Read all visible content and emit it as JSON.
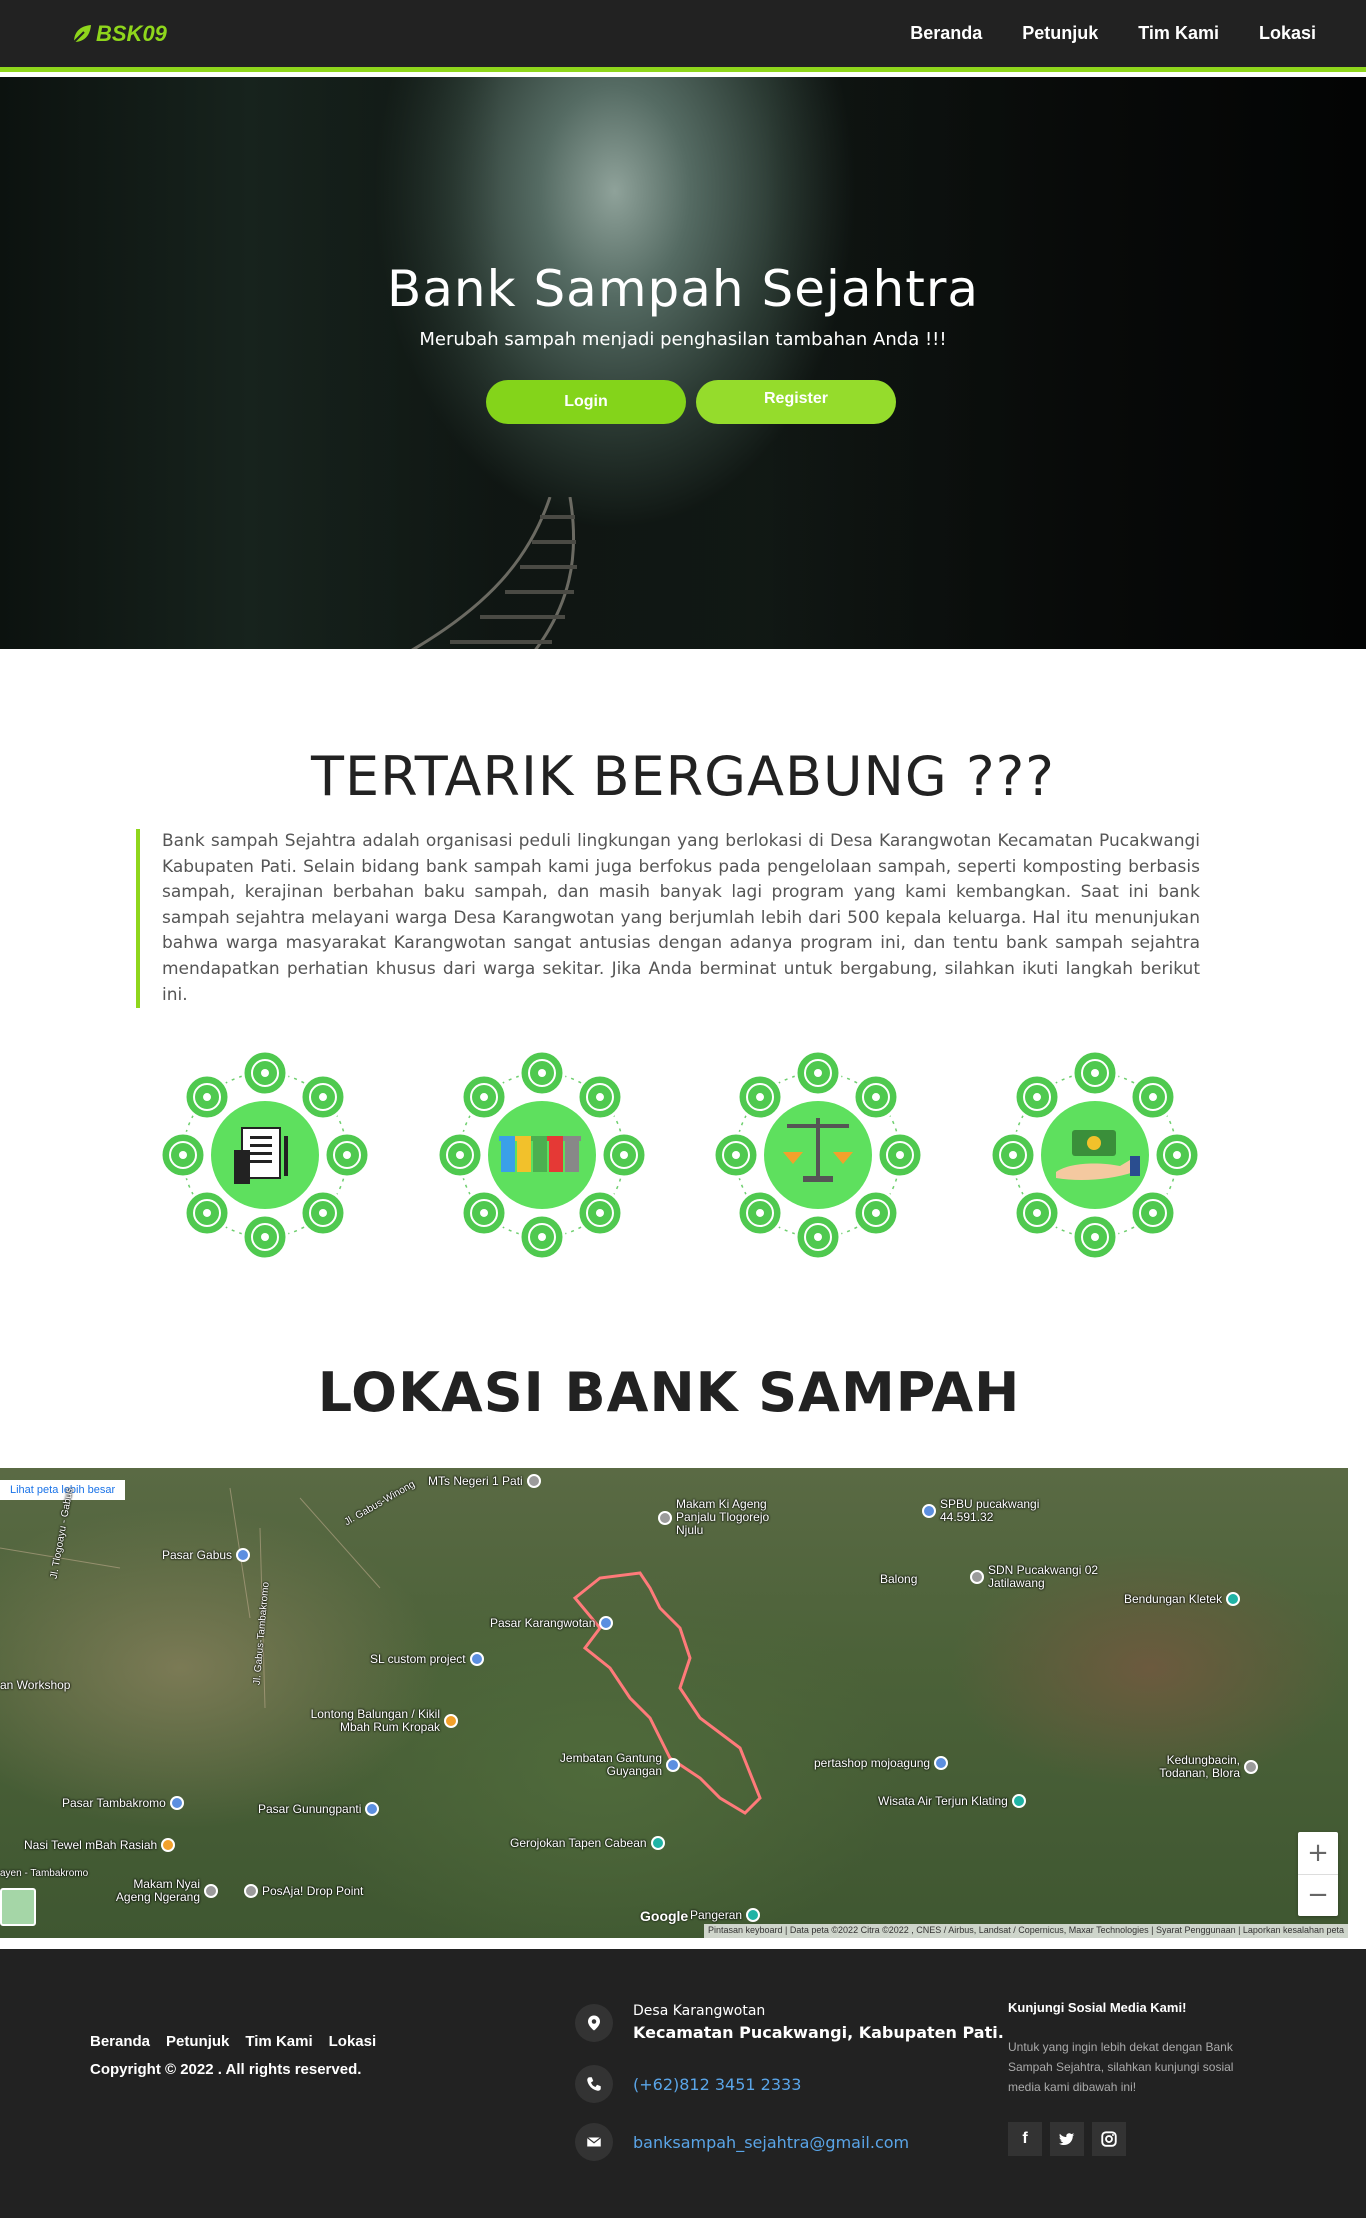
{
  "nav": {
    "logo": "BSK09",
    "items": [
      "Beranda",
      "Petunjuk",
      "Tim Kami",
      "Lokasi"
    ]
  },
  "hero": {
    "title": "Bank Sampah Sejahtra",
    "subtitle": "Merubah sampah menjadi penghasilan tambahan Anda !!!",
    "login_label": "Login",
    "register_label": "Register"
  },
  "join": {
    "title": "TERTARIK BERGABUNG ???",
    "text": "Bank sampah Sejahtra adalah organisasi peduli lingkungan yang berlokasi di Desa Karangwotan Kecamatan Pucakwangi Kabupaten Pati. Selain bidang bank sampah kami juga berfokus pada pengelolaan sampah, seperti komposting berbasis sampah, kerajinan berbahan baku sampah, dan masih banyak lagi program yang kami kembangkan. Saat ini bank sampah sejahtra melayani warga Desa Karangwotan yang berjumlah lebih dari 500 kepala keluarga. Hal itu menunjukan bahwa warga masyarakat Karangwotan sangat antusias dengan adanya program ini, dan tentu bank sampah sejahtra mendapatkan perhatian khusus dari warga sekitar. Jika Anda berminat untuk bergabung, silahkan ikuti langkah berikut ini.",
    "steps": [
      {
        "icon": "document-icon"
      },
      {
        "icon": "recycle-bins-icon"
      },
      {
        "icon": "scale-icon"
      },
      {
        "icon": "money-hand-icon"
      }
    ]
  },
  "location": {
    "title": "LOKASI BANK SAMPAH",
    "map_link": "Lihat peta lebih besar",
    "places": {
      "p1": "MTs Negeri 1 Pati",
      "p2": "Makam Ki Ageng Panjalu Tlogorejo Njulu",
      "p3": "SPBU pucakwangi 44.591.32",
      "p4": "Balong",
      "p5": "SDN Pucakwangi 02 Jatilawang",
      "p6": "Bendungan Kletek",
      "p7": "Pasar Gabus",
      "p8": "Pasar Karangwotan",
      "p9": "SL custom project",
      "p10": "an Workshop",
      "p11": "Lontong Balungan / Kikil Mbah Rum Kropak",
      "p12": "Jembatan Gantung Guyangan",
      "p13": "pertashop mojoagung",
      "p14": "Kedungbacin, Todanan, Blora",
      "p15": "Pasar Tambakromo",
      "p16": "Pasar Gunungpanti",
      "p17": "Wisata Air Terjun Klating",
      "p18": "Nasi Tewel mBah Rasiah",
      "p19": "Gerojokan Tapen Cabean",
      "p20": "Makam Nyai Ageng Ngerang",
      "p21": "PosAja! Drop Point",
      "p22": "Pangeran",
      "p23": "Jl. Tlogoayu - Gabus",
      "p24": "Jl. Gabus-Winong",
      "p25": "Jl. Gabus-Tambakromo",
      "p26": "ayen - Tambakromo"
    },
    "zoom_in": "+",
    "zoom_out": "−",
    "google": "Google",
    "attribution": "Pintasan keyboard | Data peta ©2022 Citra ©2022 , CNES / Airbus, Landsat / Copernicus, Maxar Technologies | Syarat Penggunaan | Laporkan kesalahan peta"
  },
  "footer": {
    "links": [
      "Beranda",
      "Petunjuk",
      "Tim Kami",
      "Lokasi"
    ],
    "copyright": "Copyright © 2022 . All rights reserved.",
    "address_line1": "Desa Karangwotan",
    "address_line2": "Kecamatan Pucakwangi, Kabupaten Pati.",
    "phone": "(+62)812 3451 2333",
    "email": "banksampah_sejahtra@gmail.com",
    "social_title": "Kunjungi Sosial Media Kami!",
    "social_text": "Untuk yang ingin lebih dekat dengan Bank Sampah Sejahtra, silahkan kunjungi sosial media kami dibawah ini!",
    "socials": [
      "f",
      "t",
      "i"
    ]
  },
  "colors": {
    "accent": "#8fd61c",
    "dark": "#222222",
    "link": "#5aa5e8"
  }
}
